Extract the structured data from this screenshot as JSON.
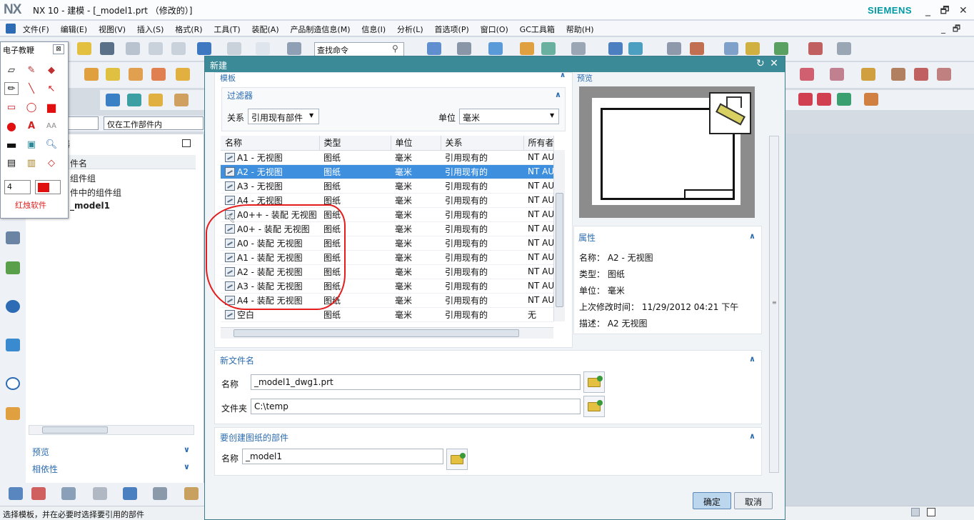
{
  "app": {
    "logo": "NX",
    "title": "NX 10 - 建模 - [_model1.prt （修改的）]",
    "brand": "SIEMENS",
    "window_controls": "_ 🗗 ✕",
    "child_controls": "_ 🗗 ✕"
  },
  "menu": [
    "文件(F)",
    "编辑(E)",
    "视图(V)",
    "插入(S)",
    "格式(R)",
    "工具(T)",
    "装配(A)",
    "产品制造信息(M)",
    "信息(I)",
    "分析(L)",
    "首选项(P)",
    "窗口(O)",
    "GC工具箱",
    "帮助(H)"
  ],
  "toolbar": {
    "search_placeholder": "查找命令"
  },
  "filter_bar": {
    "scope_value": "仅在工作部件内"
  },
  "navigator": {
    "header": "件名",
    "rows": [
      "组件组",
      "件中的组件组",
      "_model1"
    ],
    "sections": [
      "预览",
      "相依性"
    ]
  },
  "palette": {
    "title": "电子教鞭",
    "close": "⊠",
    "size_value": "4",
    "brand": "红烛软件"
  },
  "dialog": {
    "title": "新建",
    "controls": "↻ ✕",
    "templates_label": "模板",
    "filter": {
      "header": "过滤器",
      "relation_label": "关系",
      "relation_value": "引用现有部件",
      "unit_label": "单位",
      "unit_value": "毫米"
    },
    "columns": [
      "名称",
      "类型",
      "单位",
      "关系",
      "所有者"
    ],
    "rows": [
      {
        "name": "A1 - 无视图",
        "type": "图纸",
        "unit": "毫米",
        "relation": "引用现有的",
        "owner": "NT AU"
      },
      {
        "name": "A2 - 无视图",
        "type": "图纸",
        "unit": "毫米",
        "relation": "引用现有的",
        "owner": "NT AU"
      },
      {
        "name": "A3 - 无视图",
        "type": "图纸",
        "unit": "毫米",
        "relation": "引用现有的",
        "owner": "NT AU"
      },
      {
        "name": "A4 - 无视图",
        "type": "图纸",
        "unit": "毫米",
        "relation": "引用现有的",
        "owner": "NT AU"
      },
      {
        "name": "A0++ - 装配 无视图",
        "type": "图纸",
        "unit": "毫米",
        "relation": "引用现有的",
        "owner": "NT AU"
      },
      {
        "name": "A0+ - 装配 无视图",
        "type": "图纸",
        "unit": "毫米",
        "relation": "引用现有的",
        "owner": "NT AU"
      },
      {
        "name": "A0 - 装配 无视图",
        "type": "图纸",
        "unit": "毫米",
        "relation": "引用现有的",
        "owner": "NT AU"
      },
      {
        "name": "A1 - 装配 无视图",
        "type": "图纸",
        "unit": "毫米",
        "relation": "引用现有的",
        "owner": "NT AU"
      },
      {
        "name": "A2 - 装配 无视图",
        "type": "图纸",
        "unit": "毫米",
        "relation": "引用现有的",
        "owner": "NT AU"
      },
      {
        "name": "A3 - 装配 无视图",
        "type": "图纸",
        "unit": "毫米",
        "relation": "引用现有的",
        "owner": "NT AU"
      },
      {
        "name": "A4 - 装配 无视图",
        "type": "图纸",
        "unit": "毫米",
        "relation": "引用现有的",
        "owner": "NT AU"
      },
      {
        "name": "空白",
        "type": "图纸",
        "unit": "毫米",
        "relation": "引用现有的",
        "owner": "无"
      }
    ],
    "selected_row": 1,
    "preview_label": "预览",
    "properties": {
      "header": "属性",
      "name": "名称： A2 - 无视图",
      "type": "类型： 图纸",
      "unit": "单位： 毫米",
      "modified": "上次修改时间： 11/29/2012 04:21 下午",
      "description": "描述： A2 无视图"
    },
    "new_file": {
      "header": "新文件名",
      "name_label": "名称",
      "name_value": "_model1_dwg1.prt",
      "folder_label": "文件夹",
      "folder_value": "C:\\temp"
    },
    "part": {
      "header": "要创建图纸的部件",
      "name_label": "名称",
      "name_value": "_model1"
    },
    "ok": "确定",
    "cancel": "取消"
  },
  "status_text": "选择模板，并在必要时选择要引用的部件",
  "colors": {
    "dialog_titlebar": "#3b8a98",
    "selection": "#3e8fde",
    "annotation": "#e41c1c",
    "accent_text": "#2b6cb0"
  }
}
